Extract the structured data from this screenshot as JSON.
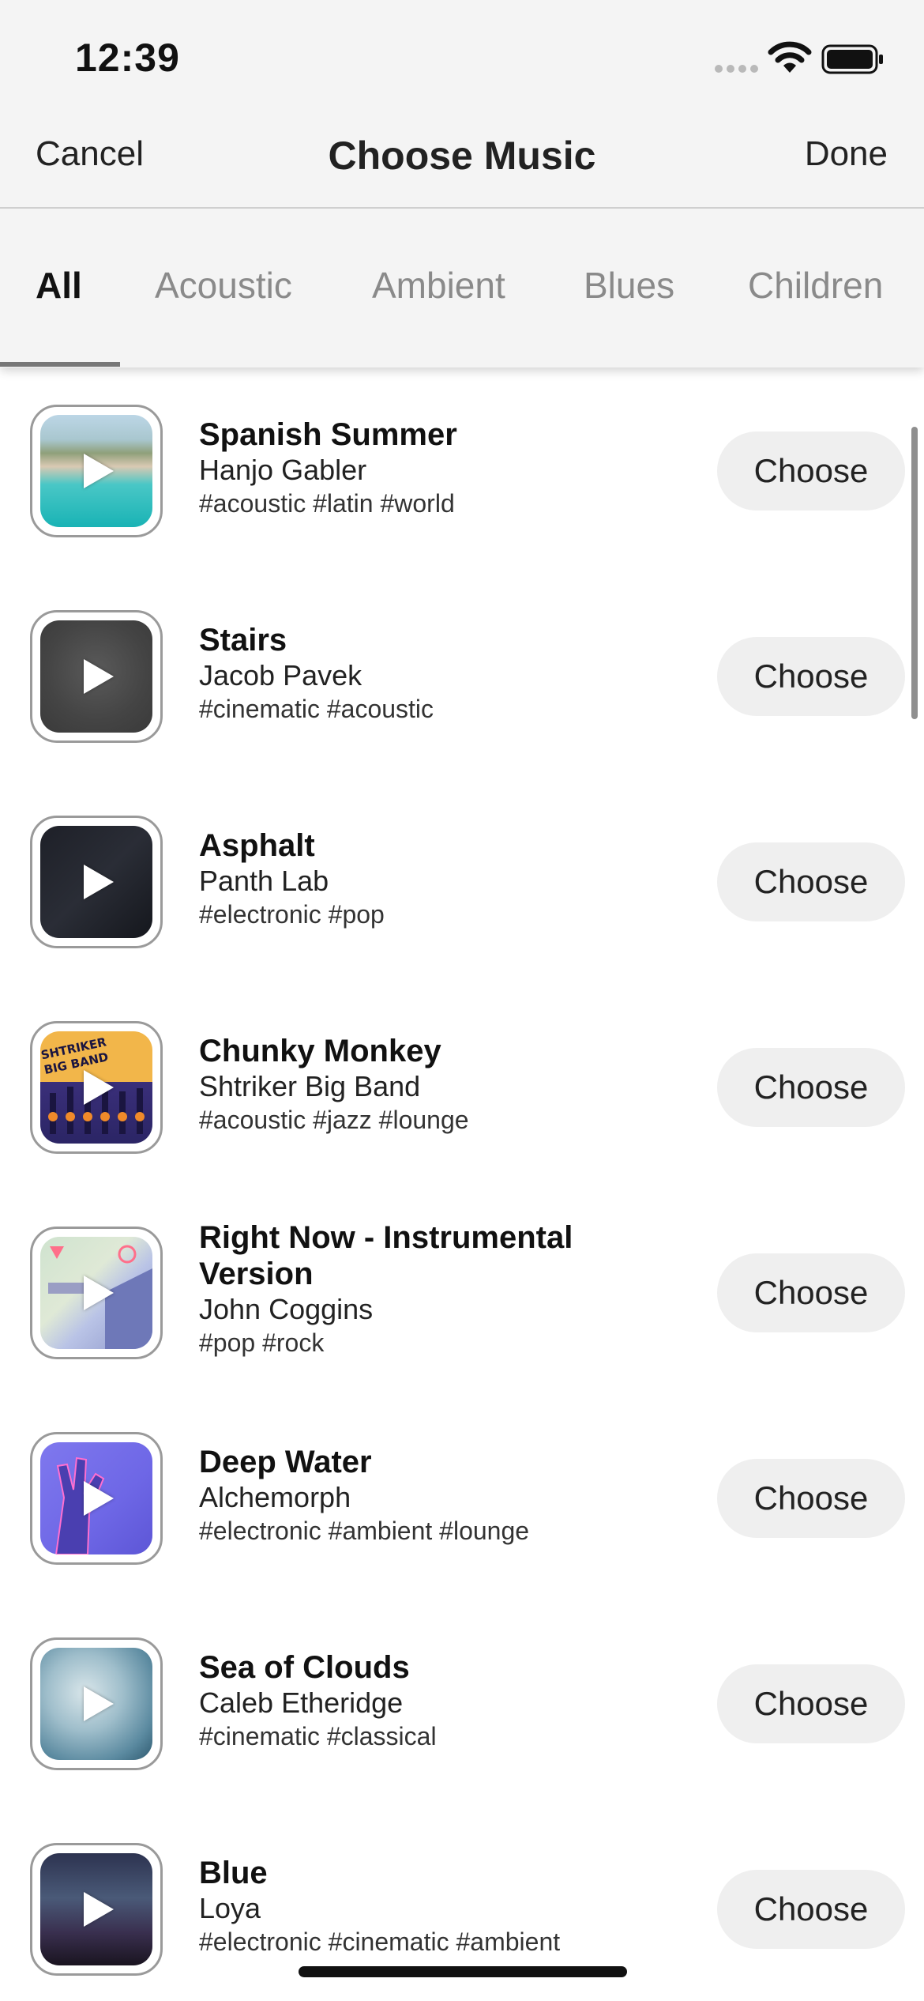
{
  "status_bar": {
    "time": "12:39"
  },
  "nav": {
    "cancel_label": "Cancel",
    "title": "Choose Music",
    "done_label": "Done"
  },
  "tabs": [
    {
      "label": "All",
      "active": true
    },
    {
      "label": "Acoustic",
      "active": false
    },
    {
      "label": "Ambient",
      "active": false
    },
    {
      "label": "Blues",
      "active": false
    },
    {
      "label": "Children",
      "active": false
    }
  ],
  "tracks": [
    {
      "title": "Spanish Summer",
      "artist": "Hanjo Gabler",
      "tags": "#acoustic #latin #world",
      "button_label": "Choose"
    },
    {
      "title": "Stairs",
      "artist": "Jacob Pavek",
      "tags": "#cinematic #acoustic",
      "button_label": "Choose"
    },
    {
      "title": "Asphalt",
      "artist": "Panth Lab",
      "tags": "#electronic #pop",
      "button_label": "Choose"
    },
    {
      "title": "Chunky Monkey",
      "artist": "Shtriker Big Band",
      "tags": "#acoustic #jazz #lounge",
      "button_label": "Choose",
      "art_text": "SHTRIKER BIG BAND"
    },
    {
      "title": "Right Now - Instrumental Version",
      "artist": "John Coggins",
      "tags": "#pop #rock",
      "button_label": "Choose"
    },
    {
      "title": "Deep Water",
      "artist": "Alchemorph",
      "tags": "#electronic #ambient #lounge",
      "button_label": "Choose"
    },
    {
      "title": "Sea of Clouds",
      "artist": "Caleb Etheridge",
      "tags": "#cinematic #classical",
      "button_label": "Choose"
    },
    {
      "title": "Blue",
      "artist": "Loya",
      "tags": "#electronic #cinematic #ambient",
      "button_label": "Choose"
    }
  ],
  "colors": {
    "top_bar_bg": "#f4f4f4",
    "choose_button_bg": "#efefef",
    "tab_inactive": "#8a8a8a"
  },
  "icons": [
    "wifi-icon",
    "battery-icon",
    "signal-dots-icon",
    "play-icon"
  ]
}
